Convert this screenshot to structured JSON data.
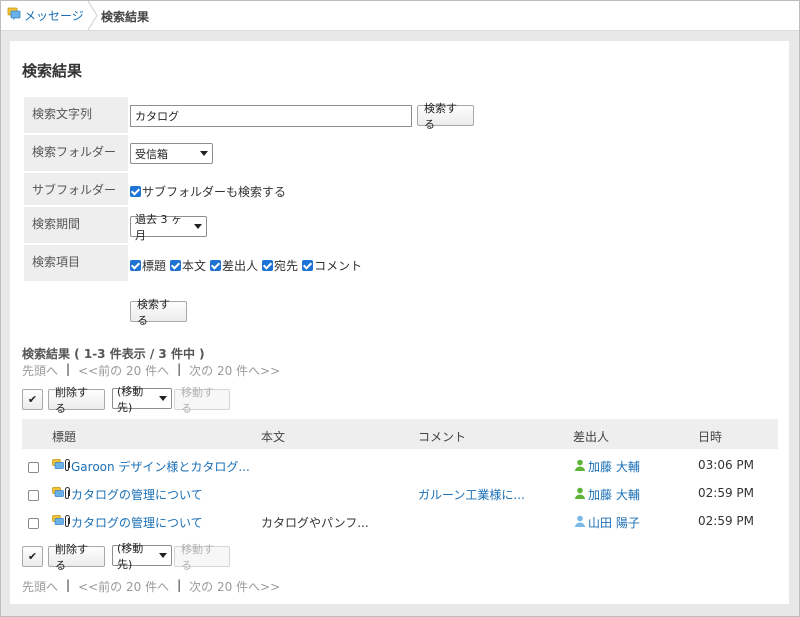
{
  "breadcrumb": {
    "home_label": "メッセージ",
    "current": "検索結果"
  },
  "page": {
    "title": "検索結果"
  },
  "form": {
    "keyword": {
      "label": "検索文字列",
      "value": "カタログ",
      "button": "検索する"
    },
    "folder": {
      "label": "検索フォルダー",
      "selected": "受信箱"
    },
    "subfolder": {
      "label": "サブフォルダー",
      "checkbox_label": "サブフォルダーも検索する",
      "checked": true
    },
    "period": {
      "label": "検索期間",
      "selected": "過去 3 ヶ月"
    },
    "items": {
      "label": "検索項目",
      "options": [
        {
          "label": "標題",
          "checked": true
        },
        {
          "label": "本文",
          "checked": true
        },
        {
          "label": "差出人",
          "checked": true
        },
        {
          "label": "宛先",
          "checked": true
        },
        {
          "label": "コメント",
          "checked": true
        }
      ]
    },
    "submit": "検索する"
  },
  "results": {
    "summary": "検索結果 ( 1-3 件表示 / 3 件中 )",
    "pager": {
      "first": "先頭へ",
      "prev": "<<前の 20 件へ",
      "next": "次の 20 件へ>>",
      "separator": "|"
    },
    "toolbar": {
      "check_all": "✔",
      "delete": "削除する",
      "move_target": "(移動先)",
      "move": "移動する"
    },
    "columns": {
      "subject": "標題",
      "body": "本文",
      "comment": "コメント",
      "sender": "差出人",
      "date": "日時"
    },
    "rows": [
      {
        "subject": "Garoon デザイン様とカタログ...",
        "body": "",
        "comment": "",
        "sender": "加藤 大輔",
        "time": "03:06 PM"
      },
      {
        "subject": "カタログの管理について",
        "body": "",
        "comment": "ガルーン工業様に...",
        "sender": "加藤 大輔",
        "time": "02:59 PM"
      },
      {
        "subject": "カタログの管理について",
        "body": "カタログやパンフ...",
        "comment": "",
        "sender": "山田 陽子",
        "time": "02:59 PM"
      }
    ]
  },
  "colors": {
    "link": "#1a6fb5",
    "checkbox": "#1d74d6",
    "header_bg": "#eeeeee",
    "frame_bg": "#e8e8e8"
  },
  "icons": {
    "message": "message-icon",
    "attachment": "paperclip-icon",
    "user_green": "user-green-icon",
    "user_blue": "user-blue-icon"
  }
}
